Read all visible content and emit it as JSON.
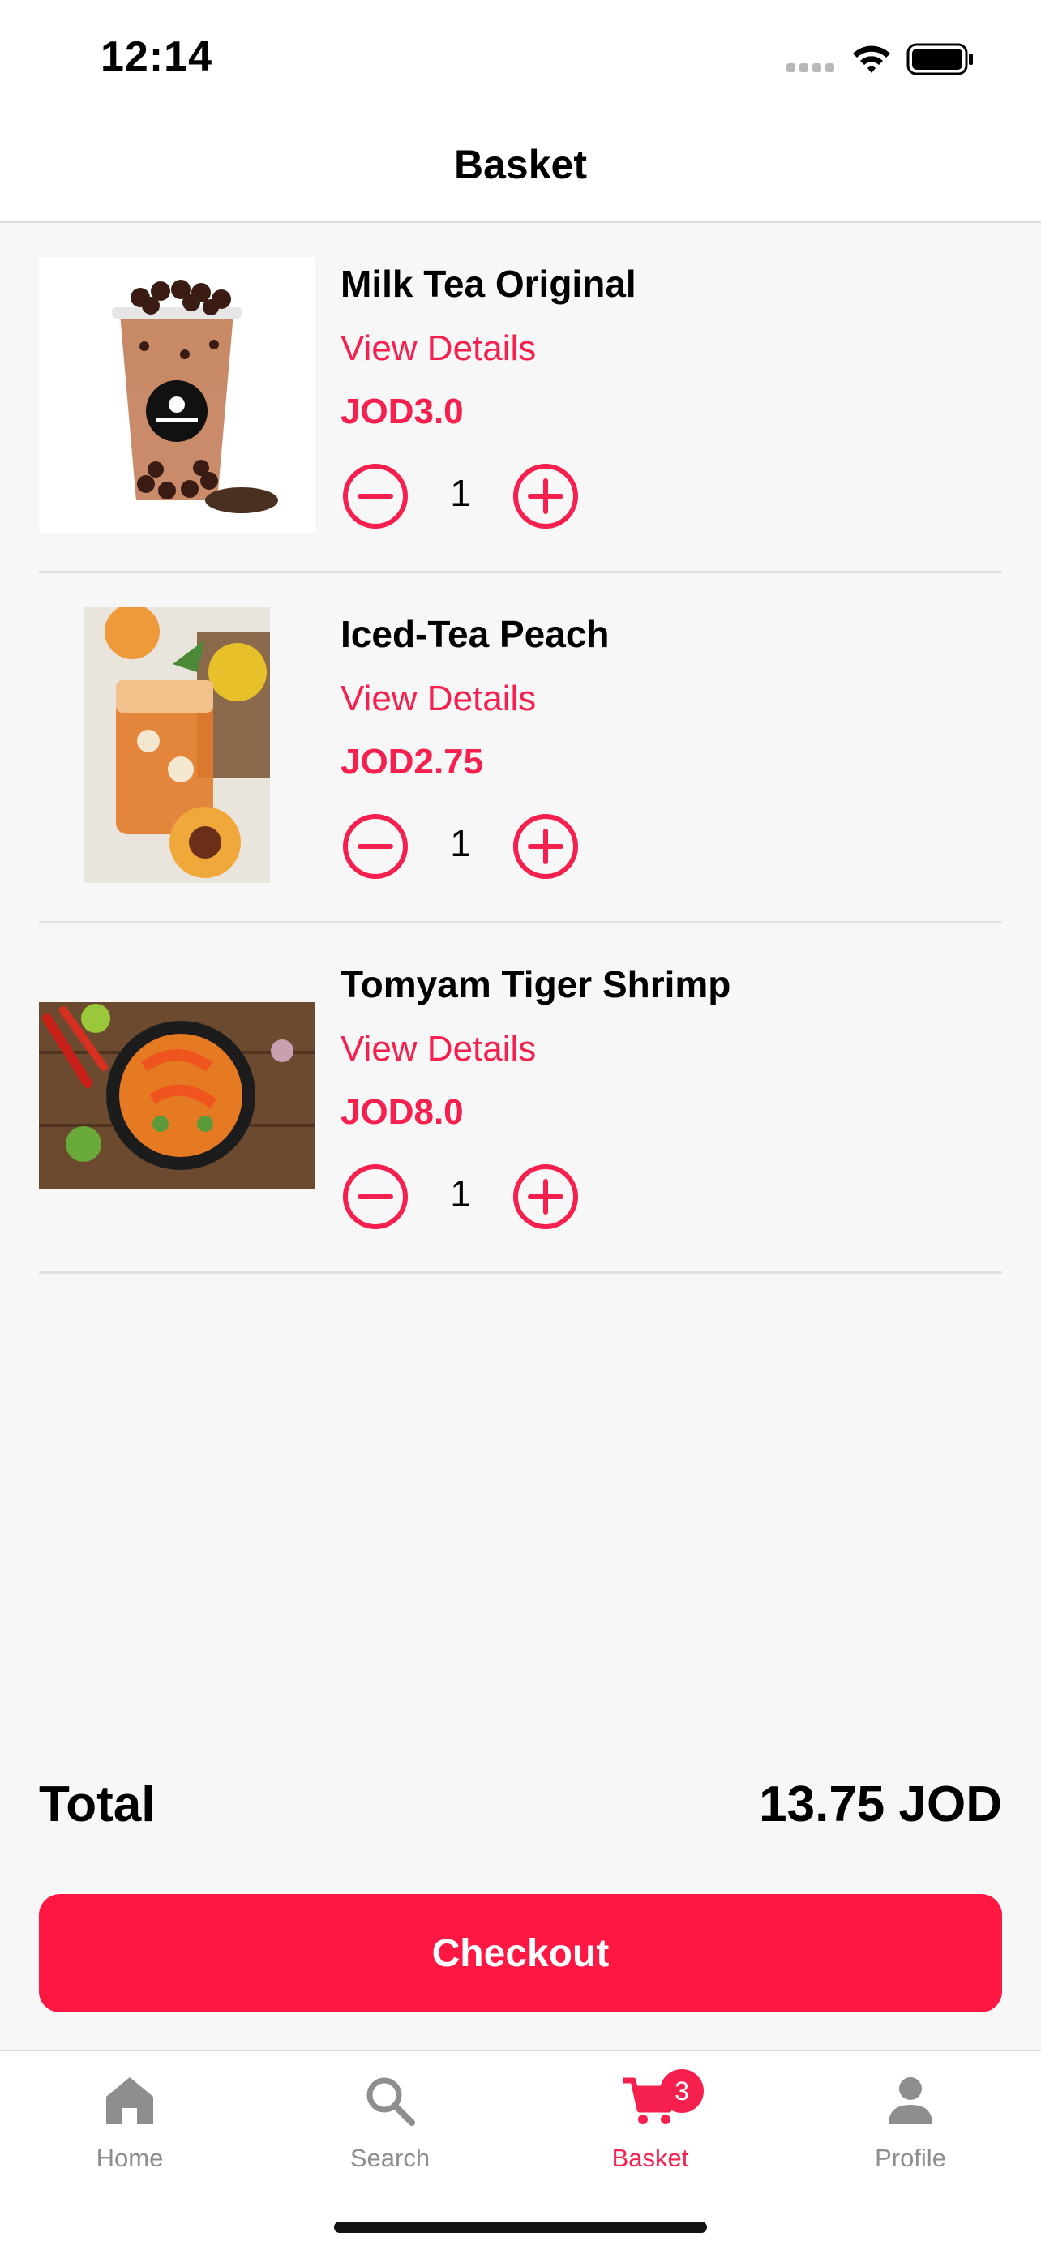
{
  "status_bar": {
    "time": "12:14"
  },
  "header": {
    "title": "Basket"
  },
  "colors": {
    "accent": "#ff1744",
    "text": "#000000",
    "muted": "#8e8e8e",
    "background": "#f7f7f7"
  },
  "items": [
    {
      "name": "Milk Tea Original",
      "details_label": "View Details",
      "price": "JOD3.0",
      "quantity": "1"
    },
    {
      "name": "Iced-Tea Peach",
      "details_label": "View Details",
      "price": "JOD2.75",
      "quantity": "1"
    },
    {
      "name": "Tomyam Tiger Shrimp",
      "details_label": "View Details",
      "price": "JOD8.0",
      "quantity": "1"
    }
  ],
  "total": {
    "label": "Total",
    "value": "13.75 JOD"
  },
  "checkout": {
    "label": "Checkout"
  },
  "tabs": [
    {
      "label": "Home",
      "icon": "home-icon"
    },
    {
      "label": "Search",
      "icon": "search-icon"
    },
    {
      "label": "Basket",
      "icon": "cart-icon",
      "badge": "3",
      "active": true
    },
    {
      "label": "Profile",
      "icon": "person-icon"
    }
  ]
}
